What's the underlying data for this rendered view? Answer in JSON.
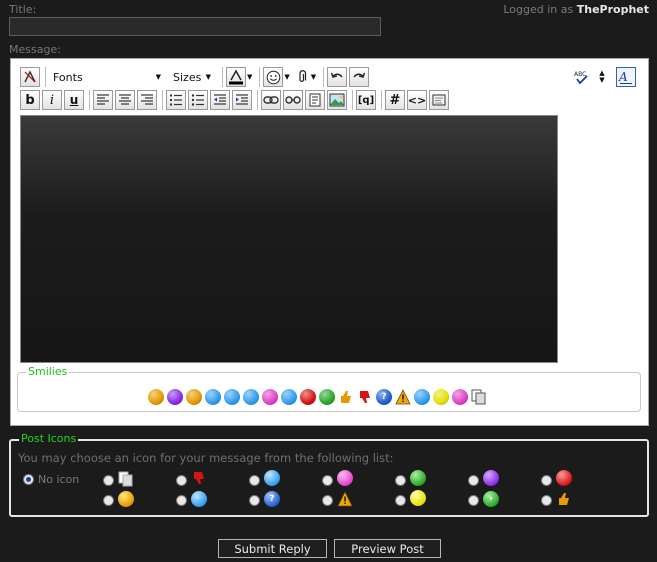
{
  "form": {
    "title_label": "Title:",
    "title_value": "",
    "login_prefix": "Logged in as",
    "username": "TheProphet",
    "message_label": "Message:"
  },
  "toolbar": {
    "font_select": "Fonts",
    "size_select": "Sizes",
    "bold": "b",
    "italic": "i",
    "underline": "u",
    "list_hash": "#",
    "code": "<>",
    "quote": "[q]"
  },
  "smilies": {
    "legend": "Smilies",
    "items": [
      {
        "icon": "smile-icon",
        "color": "#e59a00",
        "glyph": ""
      },
      {
        "icon": "angry-purple-icon",
        "color": "#8a2be2",
        "glyph": ""
      },
      {
        "icon": "grin-icon",
        "color": "#e59a00",
        "glyph": ""
      },
      {
        "icon": "shocked-icon",
        "color": "#2f9cf0",
        "glyph": ""
      },
      {
        "icon": "blue-smile-icon",
        "color": "#2f9cf0",
        "glyph": ""
      },
      {
        "icon": "cool-icon",
        "color": "#2f9cf0",
        "glyph": ""
      },
      {
        "icon": "tongue-icon",
        "color": "#e040c8",
        "glyph": ""
      },
      {
        "icon": "confused-icon",
        "color": "#2f9cf0",
        "glyph": ""
      },
      {
        "icon": "mad-red-icon",
        "color": "#d41414",
        "glyph": ""
      },
      {
        "icon": "big-grin-green-icon",
        "color": "#2aa62a",
        "glyph": ""
      },
      {
        "icon": "thumbs-up-icon",
        "color": "#e59a00",
        "glyph": "👍"
      },
      {
        "icon": "thumbs-down-icon",
        "color": "#d41414",
        "glyph": "👎"
      },
      {
        "icon": "question-icon",
        "color": "#1f5fd0",
        "glyph": "?"
      },
      {
        "icon": "warning-icon",
        "color": "#e59a00",
        "glyph": "!"
      },
      {
        "icon": "sad-icon",
        "color": "#2f9cf0",
        "glyph": ""
      },
      {
        "icon": "lightbulb-icon",
        "color": "#e6e000",
        "glyph": ""
      },
      {
        "icon": "kiss-icon",
        "color": "#e040c8",
        "glyph": ""
      },
      {
        "icon": "copy-pages-icon",
        "color": "#cccccc",
        "glyph": ""
      }
    ]
  },
  "post_icons": {
    "legend": "Post Icons",
    "description": "You may choose an icon for your message from the following list:",
    "no_icon_label": "No icon",
    "selected": "no-icon"
  },
  "buttons": {
    "submit": "Submit Reply",
    "preview": "Preview Post"
  }
}
